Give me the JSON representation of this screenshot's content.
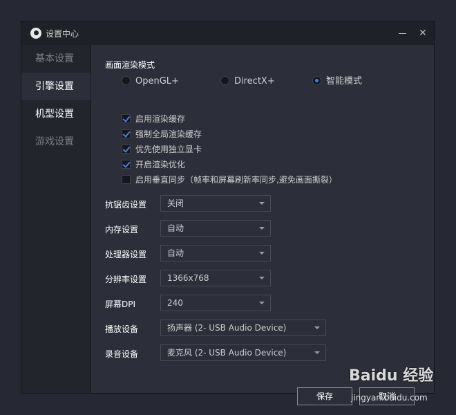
{
  "window": {
    "title": "设置中心",
    "minimize_glyph": "",
    "close_glyph": "✕"
  },
  "sidebar": {
    "items": [
      {
        "label": "基本设置",
        "state": "normal"
      },
      {
        "label": "引擎设置",
        "state": "active"
      },
      {
        "label": "机型设置",
        "state": "highlighted"
      },
      {
        "label": "游戏设置",
        "state": "normal"
      }
    ]
  },
  "render_mode": {
    "title": "画面渲染模式",
    "options": [
      {
        "label": "OpenGL+",
        "selected": false
      },
      {
        "label": "DirectX+",
        "selected": false
      },
      {
        "label": "智能模式",
        "selected": true
      }
    ]
  },
  "checkboxes": [
    {
      "label": "启用渲染缓存",
      "checked": true
    },
    {
      "label": "强制全局渲染缓存",
      "checked": true
    },
    {
      "label": "优先使用独立显卡",
      "checked": true
    },
    {
      "label": "开启渲染优化",
      "checked": true
    },
    {
      "label": "启用垂直同步（帧率和屏幕刷新率同步,避免画面撕裂）",
      "checked": false
    }
  ],
  "settings": [
    {
      "label": "抗锯齿设置",
      "value": "关闭"
    },
    {
      "label": "内存设置",
      "value": "自动"
    },
    {
      "label": "处理器设置",
      "value": "自动"
    },
    {
      "label": "分辨率设置",
      "value": "1366x768"
    },
    {
      "label": "屏幕DPI",
      "value": "240"
    },
    {
      "label": "播放设备",
      "value": "扬声器 (2- USB Audio Device)"
    },
    {
      "label": "录音设备",
      "value": "麦克风 (2- USB Audio Device)"
    }
  ],
  "buttons": {
    "save": "保存",
    "cancel": "取消"
  },
  "watermark": {
    "brand": "Baidu 经验",
    "url": "jingyan.baidu.com"
  },
  "colors": {
    "accent": "#3d86e8",
    "background": "#2c2f39",
    "sidebar": "#23252d"
  }
}
